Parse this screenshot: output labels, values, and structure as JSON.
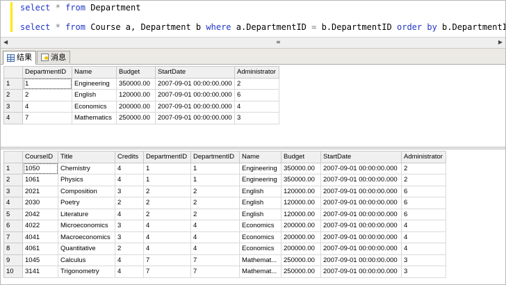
{
  "editor": {
    "line1": {
      "kw1": "select",
      "op1": "*",
      "kw2": "from",
      "t1": "Department"
    },
    "line2": {
      "kw1": "select",
      "op1": "*",
      "kw2": "from",
      "t1": "Course a, Department b",
      "kw3": "where",
      "t2": "a.DepartmentID",
      "op2": "=",
      "t3": "b.DepartmentID",
      "kw4": "order by",
      "t4": "b.DepartmentID"
    }
  },
  "tabs": {
    "results_label": "结果",
    "messages_label": "消息",
    "results_icon": "grid-icon",
    "messages_icon": "message-icon"
  },
  "grid1": {
    "columns": [
      "DepartmentID",
      "Name",
      "Budget",
      "StartDate",
      "Administrator"
    ],
    "rows": [
      [
        "1",
        "1",
        "Engineering",
        "350000.00",
        "2007-09-01 00:00:00.000",
        "2"
      ],
      [
        "2",
        "2",
        "English",
        "120000.00",
        "2007-09-01 00:00:00.000",
        "6"
      ],
      [
        "3",
        "4",
        "Economics",
        "200000.00",
        "2007-09-01 00:00:00.000",
        "4"
      ],
      [
        "4",
        "7",
        "Mathematics",
        "250000.00",
        "2007-09-01 00:00:00.000",
        "3"
      ]
    ]
  },
  "grid2": {
    "columns": [
      "CourseID",
      "Title",
      "Credits",
      "DepartmentID",
      "DepartmentID",
      "Name",
      "Budget",
      "StartDate",
      "Administrator"
    ],
    "rows": [
      [
        "1",
        "1050",
        "Chemistry",
        "4",
        "1",
        "1",
        "Engineering",
        "350000.00",
        "2007-09-01 00:00:00.000",
        "2"
      ],
      [
        "2",
        "1061",
        "Physics",
        "4",
        "1",
        "1",
        "Engineering",
        "350000.00",
        "2007-09-01 00:00:00.000",
        "2"
      ],
      [
        "3",
        "2021",
        "Composition",
        "3",
        "2",
        "2",
        "English",
        "120000.00",
        "2007-09-01 00:00:00.000",
        "6"
      ],
      [
        "4",
        "2030",
        "Poetry",
        "2",
        "2",
        "2",
        "English",
        "120000.00",
        "2007-09-01 00:00:00.000",
        "6"
      ],
      [
        "5",
        "2042",
        "Literature",
        "4",
        "2",
        "2",
        "English",
        "120000.00",
        "2007-09-01 00:00:00.000",
        "6"
      ],
      [
        "6",
        "4022",
        "Microeconomics",
        "3",
        "4",
        "4",
        "Economics",
        "200000.00",
        "2007-09-01 00:00:00.000",
        "4"
      ],
      [
        "7",
        "4041",
        "Macroeconomics",
        "3",
        "4",
        "4",
        "Economics",
        "200000.00",
        "2007-09-01 00:00:00.000",
        "4"
      ],
      [
        "8",
        "4061",
        "Quantitative",
        "2",
        "4",
        "4",
        "Economics",
        "200000.00",
        "2007-09-01 00:00:00.000",
        "4"
      ],
      [
        "9",
        "1045",
        "Calculus",
        "4",
        "7",
        "7",
        "Mathemat...",
        "250000.00",
        "2007-09-01 00:00:00.000",
        "3"
      ],
      [
        "10",
        "3141",
        "Trigonometry",
        "4",
        "7",
        "7",
        "Mathemat...",
        "250000.00",
        "2007-09-01 00:00:00.000",
        "3"
      ]
    ]
  }
}
